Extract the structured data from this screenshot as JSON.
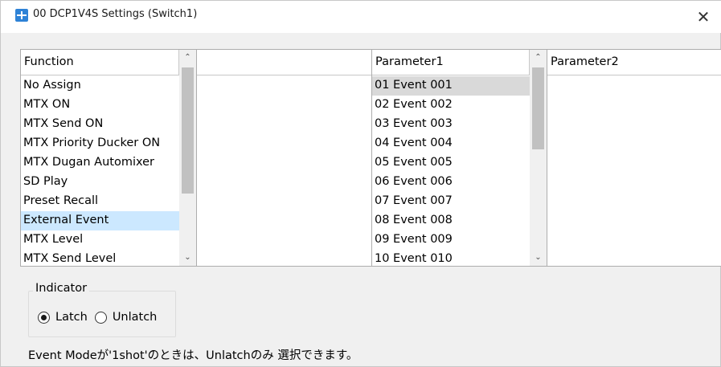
{
  "window": {
    "title": "00 DCP1V4S Settings (Switch1)",
    "close_glyph": "✕"
  },
  "function_list": {
    "header": "Function",
    "items": [
      "No Assign",
      "MTX ON",
      "MTX Send ON",
      "MTX Priority Ducker ON",
      "MTX Dugan Automixer",
      "SD Play",
      "Preset Recall",
      "External Event",
      "MTX Level",
      "MTX Send Level"
    ],
    "selected": "External Event"
  },
  "blank_list": {
    "header": ""
  },
  "parameter1_list": {
    "header": "Parameter1",
    "items": [
      "01 Event 001",
      "02 Event 002",
      "03 Event 003",
      "04 Event 004",
      "05 Event 005",
      "06 Event 006",
      "07 Event 007",
      "08 Event 008",
      "09 Event 009",
      "10 Event 010"
    ],
    "selected": "01 Event 001"
  },
  "parameter2_list": {
    "header": "Parameter2"
  },
  "scroll_glyphs": {
    "up": "⌃",
    "down": "⌄"
  },
  "indicator": {
    "label": "Indicator",
    "options": [
      "Latch",
      "Unlatch"
    ],
    "selected": "Latch"
  },
  "note": "Event Modeが'1shot'のときは、Unlatchのみ 選択できます。",
  "colors": {
    "selection_active": "#cce8ff",
    "selection_inactive": "#d9d9d9",
    "app_icon": "#2e82d6"
  },
  "icons": [
    "app-icon",
    "close-icon",
    "scroll-up-icon",
    "scroll-down-icon",
    "radio-checked-icon",
    "radio-unchecked-icon"
  ]
}
